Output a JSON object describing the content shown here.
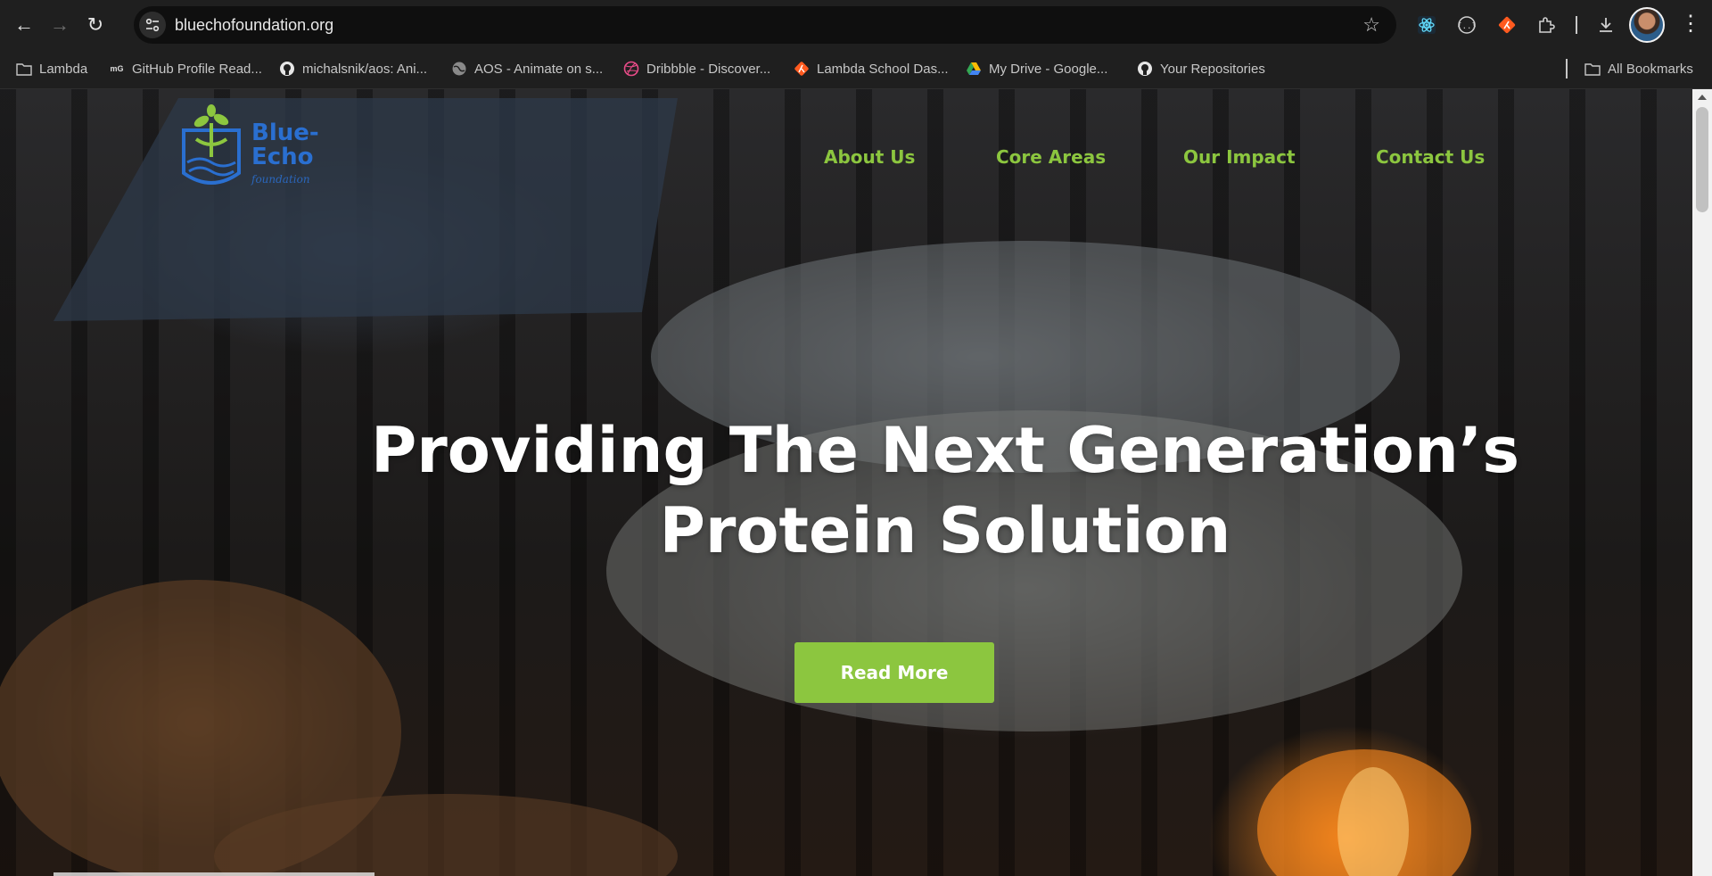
{
  "browser": {
    "url": "bluechofoundation.org",
    "bookmarks": [
      {
        "label": "Lambda",
        "icon": "folder-icon"
      },
      {
        "label": "GitHub Profile Read...",
        "icon": "md-icon"
      },
      {
        "label": "michalsnik/aos: Ani...",
        "icon": "github-icon"
      },
      {
        "label": "AOS - Animate on s...",
        "icon": "globe-icon"
      },
      {
        "label": "Dribbble - Discover...",
        "icon": "dribbble-icon"
      },
      {
        "label": "Lambda School Das...",
        "icon": "lambda-icon"
      },
      {
        "label": "My Drive - Google...",
        "icon": "drive-icon"
      },
      {
        "label": "Your Repositories",
        "icon": "github-icon"
      }
    ],
    "all_bookmarks": "All Bookmarks",
    "md_icon_text": "mG"
  },
  "site": {
    "logo_text": "Blue-\nEcho",
    "logo_sub": "foundation",
    "nav": [
      "About Us",
      "Core Areas",
      "Our Impact",
      "Contact Us"
    ],
    "hero_title": "Providing The Next Generation’s Protein Solution",
    "cta_label": "Read More",
    "colors": {
      "accent": "#8cc63f",
      "logo_blue": "#2a6fd0"
    }
  }
}
